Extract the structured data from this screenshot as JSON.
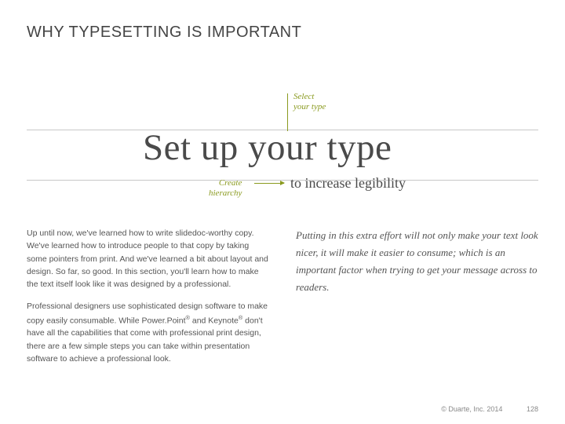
{
  "title": "WHY TYPESETTING IS IMPORTANT",
  "annotations": {
    "select": "Select\nyour type",
    "hierarchy": "Create\nhierarchy"
  },
  "headline": "Set up your type",
  "subhead": "to increase legibility",
  "body": {
    "left_p1": "Up until now, we've learned how to write slidedoc-worthy copy. We've learned how to introduce people to that copy by taking some pointers from print. And we've learned a bit about layout and design. So far, so good. In this section, you'll learn how to make the text itself look like it was designed by a professional.",
    "left_p2_a": "Professional designers use sophisticated design software to make copy easily consumable. While Power.Point",
    "left_p2_b": " and Keynote",
    "left_p2_c": " don't have all the capabilities that come with professional print design, there are a few simple steps you can take within presentation software to achieve a professional look.",
    "right": "Putting in this extra effort will not only make your text look nicer, it will make it easier to consume; which is an important factor when trying to get your message across to readers."
  },
  "footer": {
    "copyright": "© Duarte, Inc. 2014",
    "page": "128"
  }
}
